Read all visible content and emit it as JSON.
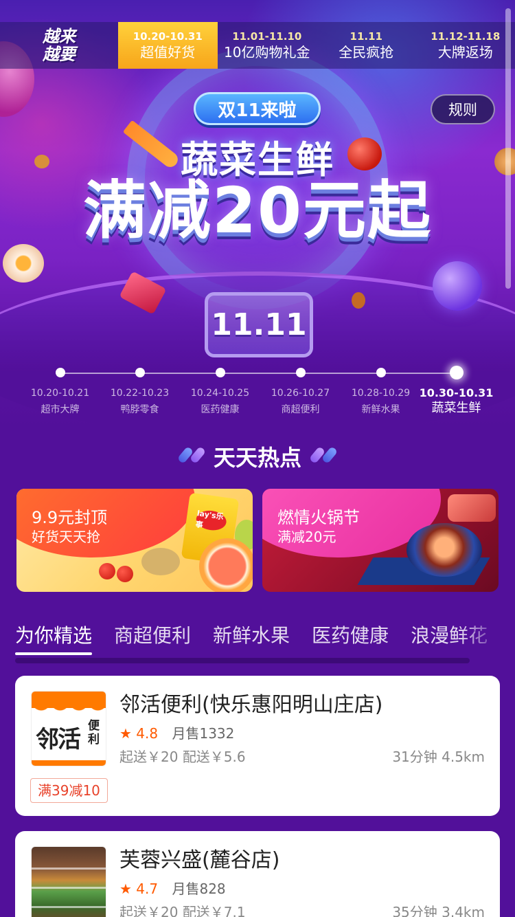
{
  "colors": {
    "page_bg": "#52109a",
    "active_phase": "#f7a51a",
    "accent_orange": "#ff5a00",
    "promo_red": "#e8422a"
  },
  "banner": {
    "logo_line1": "越来",
    "logo_line2": "越要",
    "phases": [
      {
        "date": "10.20-10.31",
        "name": "超值好货",
        "active": true
      },
      {
        "date": "11.01-11.10",
        "name": "10亿购物礼金",
        "active": false
      },
      {
        "date": "11.11",
        "name": "全民疯抢",
        "active": false
      },
      {
        "date": "11.12-11.18",
        "name": "大牌返场",
        "active": false
      }
    ],
    "rule_label": "规则",
    "badge": "双11来啦",
    "subtitle": "蔬菜生鲜",
    "headline": "满减20元起",
    "gift_text": "11.11"
  },
  "timeline": [
    {
      "date": "10.20-10.21",
      "name": "超市大牌"
    },
    {
      "date": "10.22-10.23",
      "name": "鸭脖零食"
    },
    {
      "date": "10.24-10.25",
      "name": "医药健康"
    },
    {
      "date": "10.26-10.27",
      "name": "商超便利"
    },
    {
      "date": "10.28-10.29",
      "name": "新鲜水果"
    },
    {
      "date": "10.30-10.31",
      "name": "蔬菜生鲜",
      "active": true
    }
  ],
  "hot": {
    "title": "天天热点",
    "promos": [
      {
        "title": "9.9元封顶",
        "subtitle": "好货天天抢",
        "bag_label": "lay's乐事"
      },
      {
        "title": "燃情火锅节",
        "subtitle": "满减20元"
      }
    ]
  },
  "categories": [
    {
      "label": "为你精选",
      "active": true
    },
    {
      "label": "商超便利"
    },
    {
      "label": "新鲜水果"
    },
    {
      "label": "医药健康"
    },
    {
      "label": "浪漫鲜花"
    }
  ],
  "stores": [
    {
      "name": "邻活便利(快乐惠阳明山庄店)",
      "logo_text_main": "邻活",
      "logo_text_side": "便利",
      "star": "★",
      "rating": "4.8",
      "monthly_sales": "月售1332",
      "min_order": "起送￥20",
      "delivery_fee": "配送￥5.6",
      "time": "31分钟",
      "distance": "4.5km",
      "promo": "满39减10"
    },
    {
      "name": "芙蓉兴盛(麓谷店)",
      "star": "★",
      "rating": "4.7",
      "monthly_sales": "月售828",
      "min_order": "起送￥20",
      "delivery_fee": "配送￥7.1",
      "time": "35分钟",
      "distance": "3.4km"
    }
  ]
}
